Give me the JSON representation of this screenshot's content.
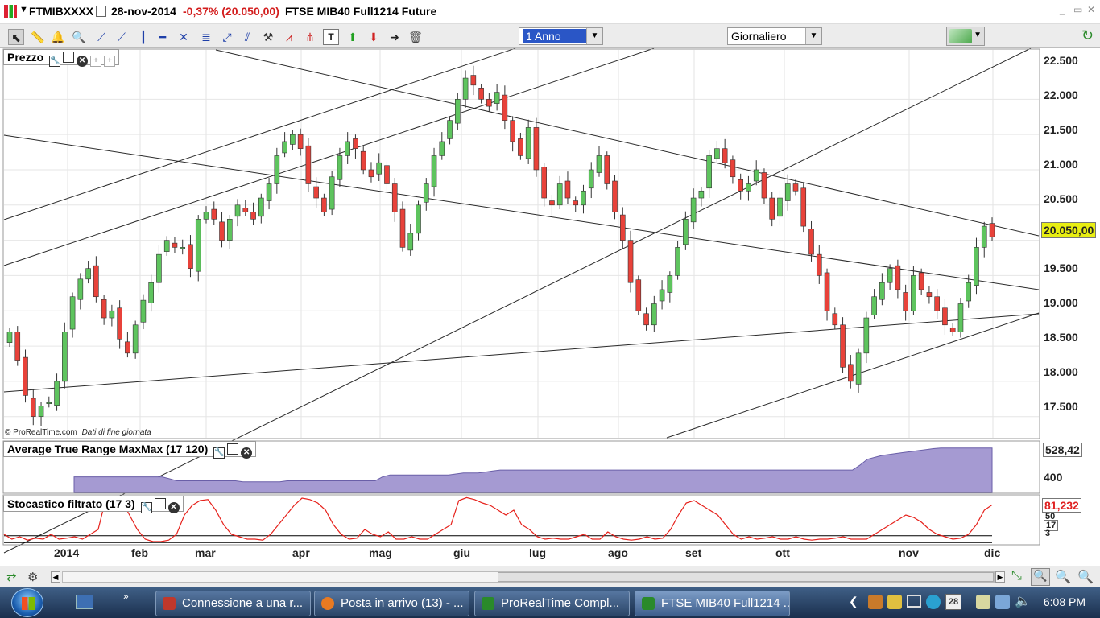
{
  "window": {
    "symbol": "FTMIBXXXX",
    "date": "28-nov-2014",
    "change": "-0,37% (20.050,00)",
    "instrument": "FTSE MIB40 Full1214 Future",
    "controls": [
      "_",
      "▭",
      "✕"
    ]
  },
  "toolbar": {
    "period": "1 Anno",
    "interval": "Giornaliero",
    "tools": [
      "pointer-icon",
      "ruler-icon",
      "alarm-icon",
      "zoom-icon",
      "line-icon",
      "ray-icon",
      "vertical-line-icon",
      "horizontal-line-icon",
      "fibonacci-icon",
      "channel-icon",
      "trend-channel-icon",
      "parallel-lines-icon",
      "tools-icon",
      "fan-icon",
      "pitchfork-icon",
      "text-icon",
      "buy-arrow-icon",
      "sell-arrow-icon",
      "right-arrow-icon",
      "trash-icon"
    ]
  },
  "colors": {
    "up": "#5ec45e",
    "down": "#e8423a",
    "atr_fill": "#a59ad2",
    "stoch": "#e6211b"
  },
  "price_panel": {
    "label": "Prezzo",
    "copyright": "© ProRealTime.com",
    "note": "Dati di fine giornata",
    "current_price": "20.050,00",
    "yticks": [
      "22.500",
      "22.000",
      "21.500",
      "21.000",
      "20.500",
      "20.050,00",
      "19.500",
      "19.000",
      "18.500",
      "18.000",
      "17.500"
    ]
  },
  "atr_panel": {
    "label": "Average True Range MaxMax (17 120)",
    "value": "528,42",
    "tick": "400"
  },
  "stoch_panel": {
    "label": "Stocastico filtrato (17 3)",
    "value": "81,232",
    "ticks": [
      "50",
      "17",
      "3"
    ]
  },
  "x_axis": {
    "labels": [
      "2014",
      "feb",
      "mar",
      "apr",
      "mag",
      "giu",
      "lug",
      "ago",
      "set",
      "ott",
      "nov",
      "dic"
    ]
  },
  "chart_data": [
    {
      "type": "line",
      "title": "",
      "ylim": [
        17200,
        22700
      ],
      "yticks": [
        17500,
        18000,
        18500,
        19000,
        19500,
        20000,
        20500,
        21000,
        21500,
        22000,
        22500
      ],
      "x_labels": [
        "2014",
        "feb",
        "mar",
        "apr",
        "mag",
        "giu",
        "lug",
        "ago",
        "set",
        "ott",
        "nov",
        "dic"
      ],
      "last_close": 20050,
      "series": [
        {
          "values": [
            18700,
            18300,
            17800,
            17500,
            17650,
            17700,
            18000,
            18700,
            19200,
            19450,
            19600,
            19200,
            18900,
            19000,
            18600,
            18400,
            18800,
            19150,
            19400,
            19800,
            20000,
            19900,
            19900,
            19600,
            20300,
            20400,
            20300,
            20000,
            20300,
            20500,
            20400,
            20300,
            20600,
            20800,
            21200,
            21400,
            21500,
            21300,
            20800,
            20600,
            20400,
            20900,
            21200,
            21400,
            21300,
            21000,
            20900,
            21100,
            20800,
            20400,
            19900,
            20100,
            20500,
            20800,
            21200,
            21400,
            21700,
            22000,
            22300,
            22200,
            22000,
            21900,
            22100,
            21700,
            21400,
            21200,
            21600,
            21000,
            20600,
            20500,
            20800,
            20600,
            20500,
            20700,
            21000,
            21200,
            20800,
            20400,
            20000,
            19400,
            19000,
            18800,
            19100,
            19300,
            19500,
            19900,
            20300,
            20600,
            20700,
            21200,
            21300,
            21100,
            20900,
            20700,
            20800,
            21000,
            20600,
            20300,
            20600,
            20800,
            20700,
            20200,
            19800,
            19500,
            19000,
            18800,
            18200,
            18000,
            18400,
            18900,
            19200,
            19400,
            19600,
            19300,
            19000,
            19500,
            19300,
            19200,
            19000,
            18800,
            18700,
            19100,
            19400,
            19900,
            20200,
            20050
          ]
        }
      ]
    },
    {
      "type": "area",
      "title": "Average True Range MaxMax (17 120)",
      "ylim": [
        300,
        560
      ],
      "last_value": 528.42,
      "series": [
        {
          "values": [
            380,
            380,
            380,
            380,
            380,
            380,
            380,
            380,
            380,
            380,
            380,
            380,
            380,
            370,
            360,
            360,
            360,
            360,
            360,
            360,
            360,
            360,
            360,
            355,
            355,
            355,
            355,
            355,
            355,
            360,
            360,
            360,
            360,
            360,
            360,
            360,
            360,
            360,
            360,
            360,
            360,
            360,
            380,
            390,
            390,
            390,
            390,
            390,
            390,
            390,
            390,
            390,
            395,
            400,
            400,
            400,
            405,
            410,
            415,
            415,
            415,
            415,
            415,
            415,
            415,
            415,
            415,
            415,
            415,
            415,
            415,
            415,
            415,
            415,
            415,
            415,
            415,
            415,
            415,
            415,
            415,
            415,
            415,
            415,
            415,
            415,
            415,
            415,
            415,
            415,
            415,
            415,
            415,
            415,
            415,
            415,
            415,
            415,
            415,
            415,
            415,
            415,
            415,
            415,
            415,
            415,
            415,
            440,
            470,
            480,
            490,
            495,
            500,
            505,
            510,
            515,
            520,
            525,
            528,
            528,
            528,
            528,
            528,
            528,
            528,
            528
          ]
        }
      ]
    },
    {
      "type": "line",
      "title": "Stocastico filtrato (17 3)",
      "ylim": [
        0,
        100
      ],
      "last_value": 81.232,
      "series": [
        {
          "values": [
            20,
            10,
            15,
            8,
            12,
            10,
            20,
            10,
            12,
            15,
            10,
            20,
            30,
            95,
            96,
            90,
            60,
            30,
            10,
            5,
            5,
            8,
            20,
            60,
            80,
            90,
            92,
            70,
            40,
            20,
            15,
            10,
            10,
            8,
            20,
            40,
            60,
            80,
            95,
            92,
            85,
            70,
            40,
            20,
            10,
            12,
            30,
            20,
            15,
            25,
            10,
            10,
            15,
            10,
            10,
            20,
            30,
            40,
            90,
            96,
            92,
            85,
            80,
            70,
            60,
            70,
            40,
            30,
            15,
            10,
            12,
            10,
            10,
            15,
            20,
            10,
            10,
            25,
            15,
            10,
            8,
            10,
            15,
            10,
            12,
            30,
            60,
            85,
            90,
            80,
            70,
            60,
            40,
            20,
            10,
            15,
            10,
            12,
            15,
            10,
            10,
            15,
            10,
            8,
            10,
            10,
            12,
            15,
            10,
            10,
            10,
            20,
            30,
            40,
            50,
            60,
            55,
            45,
            30,
            20,
            15,
            10,
            12,
            20,
            40,
            70,
            81
          ]
        }
      ]
    }
  ],
  "scroll": {
    "left_arrow": "◀",
    "right_arrow": "▶"
  },
  "taskbar": {
    "items": [
      {
        "label": "Connessione a una r...",
        "icon_color": "#c0382b"
      },
      {
        "label": "Posta in arrivo (13) - ...",
        "icon_color": "#e87a22"
      },
      {
        "label": "ProRealTime Compl...",
        "icon_color": "#2a8a2a"
      },
      {
        "label": "FTSE MIB40 Full1214 ...",
        "icon_color": "#2a8a2a"
      }
    ],
    "clock": "6:08 PM",
    "tray_date": "28"
  }
}
